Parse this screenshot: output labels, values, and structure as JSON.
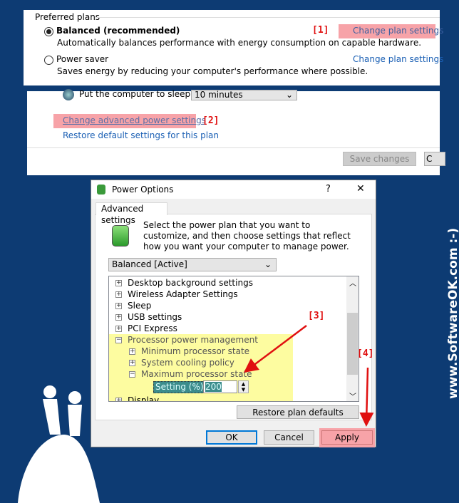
{
  "top_panel": {
    "group_label": "Preferred plans",
    "plans": [
      {
        "name": "Balanced (recommended)",
        "description": "Automatically balances performance with energy consumption on capable hardware.",
        "link": "Change plan settings",
        "selected": true
      },
      {
        "name": "Power saver",
        "description": "Saves energy by reducing your computer's performance where possible.",
        "link": "Change plan settings",
        "selected": false
      }
    ]
  },
  "edit_panel": {
    "sleep_label": "Put the computer to sleep:",
    "sleep_value": "10 minutes",
    "advanced_link": "Change advanced power settings",
    "restore_link": "Restore default settings for this plan",
    "save_button": "Save changes",
    "cancel_button_partial": "C"
  },
  "annotations": {
    "a1": "[1]",
    "a2": "[2]",
    "a3": "[3]",
    "a4": "[4]",
    "color": "#e01010",
    "highlight": "#f7a3a8"
  },
  "dialog": {
    "title": "Power Options",
    "help": "?",
    "close": "✕",
    "tab": "Advanced settings",
    "intro": "Select the power plan that you want to customize, and then choose settings that reflect how you want your computer to manage power.",
    "plan_select": "Balanced [Active]",
    "tree": [
      {
        "label": "Desktop background settings",
        "expander": "+"
      },
      {
        "label": "Wireless Adapter Settings",
        "expander": "+"
      },
      {
        "label": "Sleep",
        "expander": "+"
      },
      {
        "label": "USB settings",
        "expander": "+"
      },
      {
        "label": "PCI Express",
        "expander": "+"
      },
      {
        "label": "Processor power management",
        "expander": "−"
      },
      {
        "label": "Minimum processor state",
        "expander": "+"
      },
      {
        "label": "System cooling policy",
        "expander": "+"
      },
      {
        "label": "Maximum processor state",
        "expander": "−"
      }
    ],
    "setting_label": "Setting (%):",
    "setting_value": "200",
    "next_item": "Display",
    "restore_button": "Restore plan defaults",
    "ok": "OK",
    "cancel": "Cancel",
    "apply": "Apply"
  },
  "watermark": "www.SoftwareOK.com :-)"
}
